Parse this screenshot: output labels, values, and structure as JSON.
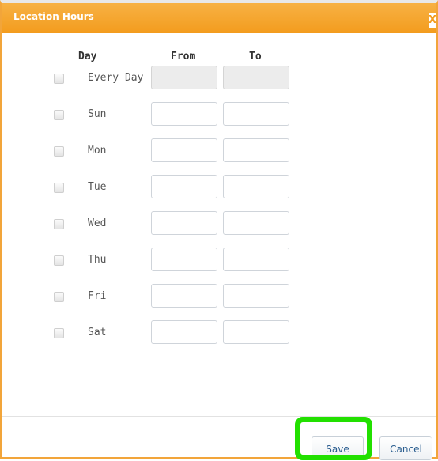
{
  "dialog": {
    "title": "Location Hours",
    "close_label": "X"
  },
  "table": {
    "headers": {
      "day": "Day",
      "from": "From",
      "to": "To"
    },
    "rows": [
      {
        "day": "Every Day",
        "checked": false,
        "from": "",
        "to": "",
        "disabled": true
      },
      {
        "day": "Sun",
        "checked": false,
        "from": "",
        "to": "",
        "disabled": false
      },
      {
        "day": "Mon",
        "checked": false,
        "from": "",
        "to": "",
        "disabled": false
      },
      {
        "day": "Tue",
        "checked": false,
        "from": "",
        "to": "",
        "disabled": false
      },
      {
        "day": "Wed",
        "checked": false,
        "from": "",
        "to": "",
        "disabled": false
      },
      {
        "day": "Thu",
        "checked": false,
        "from": "",
        "to": "",
        "disabled": false
      },
      {
        "day": "Fri",
        "checked": false,
        "from": "",
        "to": "",
        "disabled": false
      },
      {
        "day": "Sat",
        "checked": false,
        "from": "",
        "to": "",
        "disabled": false
      }
    ]
  },
  "footer": {
    "save_label": "Save",
    "cancel_label": "Cancel"
  },
  "colors": {
    "titlebar": "#f39c1e",
    "highlight": "#22e000",
    "button_text": "#2a5d8f"
  }
}
